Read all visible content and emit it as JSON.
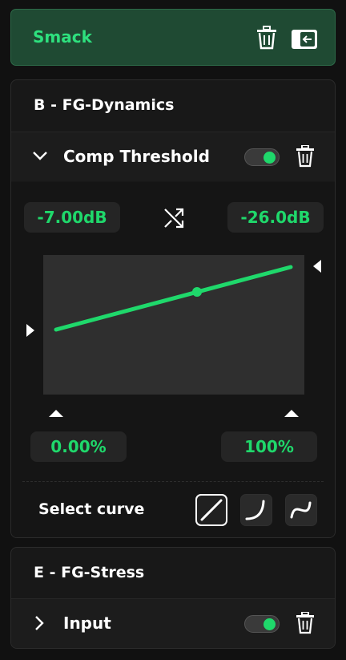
{
  "header": {
    "title": "Smack",
    "delete_icon": "trash-icon",
    "collapse_icon": "panel-collapse-icon"
  },
  "group_b": {
    "title": "B - FG-Dynamics",
    "param": {
      "label": "Comp Threshold",
      "enabled": true,
      "expanded": true,
      "range_start": "-7.00dB",
      "range_end": "-26.0dB",
      "input_min": "0.00%",
      "input_max": "100%",
      "select_curve_label": "Select curve",
      "curves": [
        "linear-curve-icon",
        "exponential-curve-icon",
        "s-curve-icon"
      ],
      "selected_curve": "linear"
    }
  },
  "group_e": {
    "title": "E - FG-Stress",
    "param": {
      "label": "Input",
      "enabled": true,
      "expanded": false
    }
  },
  "colors": {
    "accent": "#1fd86b",
    "header_bg": "#1f4a33"
  }
}
